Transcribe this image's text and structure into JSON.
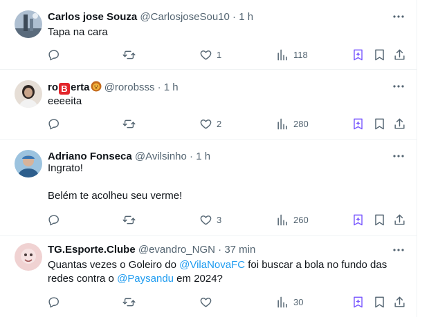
{
  "tweets": [
    {
      "name": "Carlos jose Souza",
      "handle": "@CarlosjoseSou10",
      "time": "1 h",
      "text_lines": [
        "Tapa na cara"
      ],
      "reply_count": "",
      "repost_count": "",
      "like_count": "1",
      "view_count": "118",
      "avatar_color": "#7f93a8"
    },
    {
      "name_parts": [
        "ro",
        "B",
        "erta"
      ],
      "name_emoji": "lion-face-emoji",
      "handle": "@rorobsss",
      "time": "1 h",
      "text_lines": [
        "eeeeita"
      ],
      "reply_count": "",
      "repost_count": "",
      "like_count": "2",
      "view_count": "280",
      "avatar_color": "#c9b7a6"
    },
    {
      "name": "Adriano Fonseca",
      "handle": "@Avilsinho",
      "time": "1 h",
      "text_lines": [
        "Ingrato!",
        "",
        "Belém te acolheu seu verme!"
      ],
      "reply_count": "",
      "repost_count": "",
      "like_count": "3",
      "view_count": "260",
      "avatar_color": "#5f8fb3"
    },
    {
      "name": "TG.Esporte.Clube",
      "handle": "@evandro_NGN",
      "time": "37 min",
      "text_segments": [
        {
          "text": "Quantas vezes o Goleiro do ",
          "type": "text"
        },
        {
          "text": "@VilaNovaFC",
          "type": "mention"
        },
        {
          "text": " foi buscar a bola no fundo das",
          "type": "text"
        },
        {
          "text": "redes contra o ",
          "type": "text"
        },
        {
          "text": "@Paysandu",
          "type": "mention"
        },
        {
          "text": " em 2024?",
          "type": "text"
        }
      ],
      "reply_count": "",
      "repost_count": "",
      "like_count": "",
      "view_count": "30",
      "avatar_color": "#e7b6b6"
    }
  ],
  "separator": " · ",
  "colors": {
    "text": "#0f1419",
    "secondary": "#536471",
    "link": "#1d9bf0",
    "grok": "#7856ff",
    "divider": "#eff3f4"
  },
  "icons": [
    "more-icon",
    "reply-icon",
    "repost-icon",
    "like-icon",
    "views-icon",
    "grok-icon",
    "bookmark-icon",
    "share-icon"
  ]
}
